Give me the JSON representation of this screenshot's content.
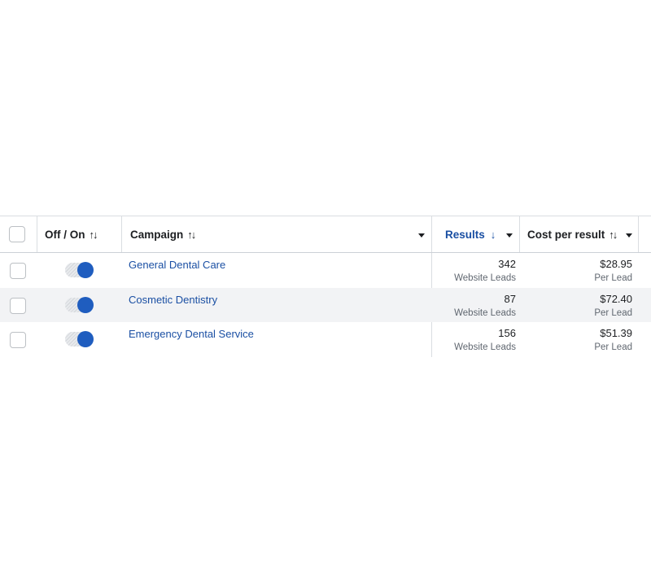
{
  "header": {
    "off_on": "Off / On",
    "campaign": "Campaign",
    "results": "Results",
    "cost_per_result": "Cost per result",
    "sort_icon": "↑↓",
    "results_sort_icon": "↓"
  },
  "rows": [
    {
      "campaign": "General Dental Care",
      "results": "342",
      "results_type": "Website Leads",
      "cost": "$28.95",
      "cost_type": "Per Lead",
      "enabled": true
    },
    {
      "campaign": "Cosmetic Dentistry",
      "results": "87",
      "results_type": "Website Leads",
      "cost": "$72.40",
      "cost_type": "Per Lead",
      "enabled": true
    },
    {
      "campaign": "Emergency Dental Service",
      "results": "156",
      "results_type": "Website Leads",
      "cost": "$51.39",
      "cost_type": "Per Lead",
      "enabled": true
    }
  ],
  "colors": {
    "accent": "#1f5dbf",
    "link": "#1a4fa3",
    "alt_row": "#f2f3f5"
  }
}
